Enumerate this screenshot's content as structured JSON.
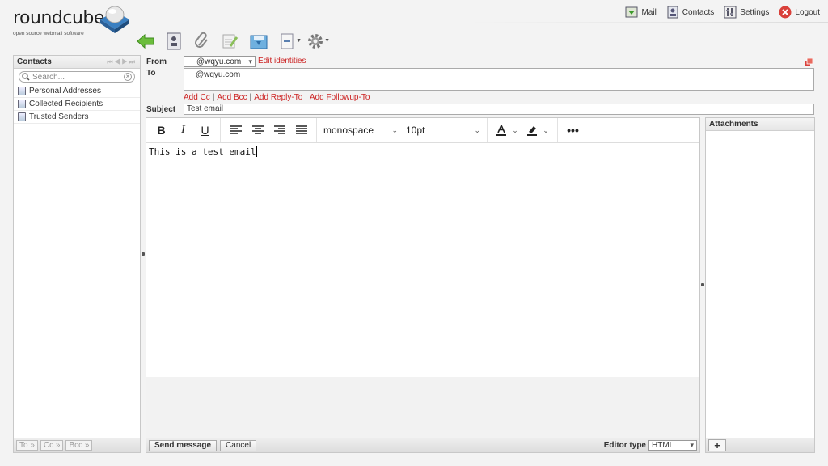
{
  "logo": {
    "wordmark": "roundcube",
    "tagline": "open source webmail software"
  },
  "topnav": [
    {
      "label": "Mail",
      "icon": "mail-icon"
    },
    {
      "label": "Contacts",
      "icon": "contacts-icon"
    },
    {
      "label": "Settings",
      "icon": "settings-icon"
    },
    {
      "label": "Logout",
      "icon": "logout-icon"
    }
  ],
  "toolbar": [
    "back-icon",
    "address-book-icon",
    "attachment-icon",
    "signature-icon",
    "save-icon",
    "priority-icon",
    "options-icon"
  ],
  "contacts": {
    "title": "Contacts",
    "search_placeholder": "Search...",
    "items": [
      "Personal Addresses",
      "Collected Recipients",
      "Trusted Senders"
    ],
    "footer": {
      "to": "To »",
      "cc": "Cc »",
      "bcc": "Bcc »"
    }
  },
  "compose": {
    "from_label": "From",
    "from_value": "@wqyu.com",
    "edit_identities": "Edit identities",
    "to_label": "To",
    "to_value": "@wqyu.com",
    "add_cc": "Add Cc",
    "add_bcc": "Add Bcc",
    "add_reply_to": "Add Reply-To",
    "add_followup_to": "Add Followup-To",
    "subject_label": "Subject",
    "subject_value": "Test email"
  },
  "editor": {
    "font_family": "monospace",
    "font_size": "10pt",
    "body": "This is a test email",
    "send_label": "Send message",
    "cancel_label": "Cancel",
    "editor_type_label": "Editor type",
    "editor_type_value": "HTML"
  },
  "attachments": {
    "title": "Attachments",
    "add_label": "+"
  },
  "colors": {
    "link": "#cc2222",
    "background": "#f3f3f3",
    "logo_blue": "#3a7fc1"
  }
}
